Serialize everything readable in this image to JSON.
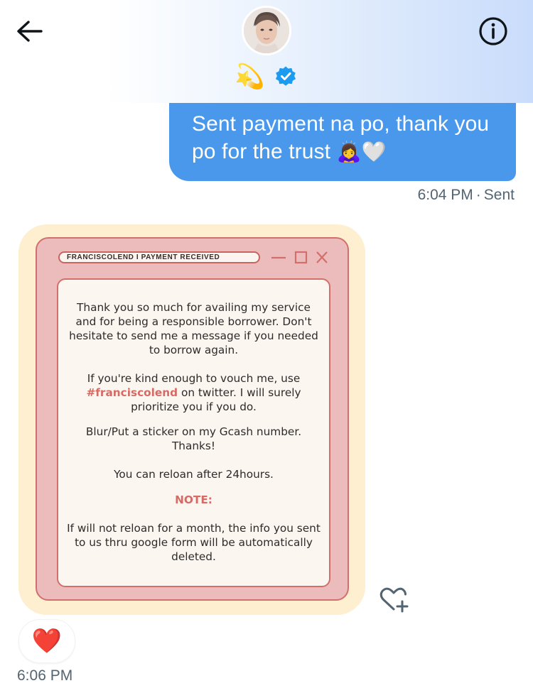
{
  "header": {
    "status_emoji": "💫",
    "icons": {
      "back": "arrow-left-icon",
      "info": "info-circle-icon",
      "verified": "verified-badge-icon"
    },
    "colors": {
      "verified": "#1d9bf0",
      "accent": "#4a98eb"
    }
  },
  "messages": {
    "outgoing": {
      "text": "Sent payment na po, thank you po for the trust",
      "emojis": "🙇‍♀️🤍",
      "time": "6:04 PM",
      "status": "Sent"
    },
    "incoming": {
      "image": {
        "title_bar": "FRANCISCOLEND I PAYMENT RECEIVED",
        "paragraph1": "Thank you so much for availing my service and for being a responsible borrower. Don't hesitate to send me a message if you needed to borrow again.",
        "paragraph2_before": "If you're kind enough to vouch me, use",
        "hashtag": "#franciscolend",
        "paragraph2_after": "on twitter. I will surely prioritize you if you do.",
        "paragraph3": "Blur/Put a sticker on my Gcash number. Thanks!",
        "paragraph4": "You can reloan after 24hours.",
        "note_label": "NOTE:",
        "note_text": "If will not reloan for a month, the info you sent to us thru google form will be automatically deleted."
      },
      "reaction": "❤️",
      "time": "6:06 PM"
    }
  }
}
